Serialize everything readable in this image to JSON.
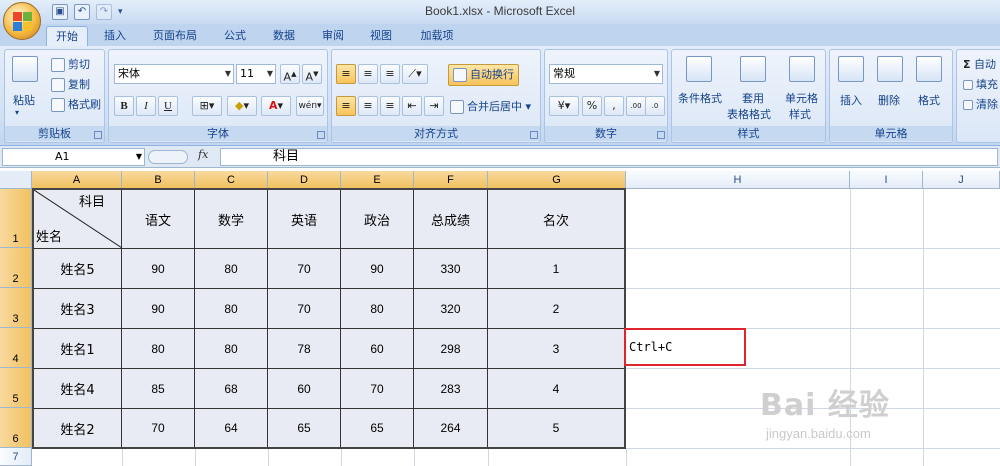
{
  "window": {
    "title": "Book1.xlsx - Microsoft Excel"
  },
  "ribbon": {
    "tabs": [
      "开始",
      "插入",
      "页面布局",
      "公式",
      "数据",
      "审阅",
      "视图",
      "加载项"
    ],
    "active_tab": "开始",
    "clipboard": {
      "paste": "粘贴",
      "cut": "剪切",
      "copy": "复制",
      "format_painter": "格式刷",
      "label": "剪贴板"
    },
    "font": {
      "name": "宋体",
      "size": "11",
      "bold": "B",
      "italic": "I",
      "underline": "U",
      "label": "字体"
    },
    "alignment": {
      "wrap_text": "自动换行",
      "merge_center": "合并后居中",
      "label": "对齐方式"
    },
    "number": {
      "format": "常规",
      "percent": "%",
      "comma": ",",
      "label": "数字"
    },
    "styles": {
      "conditional": "条件格式",
      "table_format_1": "套用",
      "table_format_2": "表格格式",
      "cell_style_1": "单元格",
      "cell_style_2": "样式",
      "label": "样式"
    },
    "cells": {
      "insert": "插入",
      "delete": "删除",
      "format": "格式",
      "label": "单元格"
    },
    "editing": {
      "autosum": "自动",
      "fill": "填充",
      "clear": "清除"
    }
  },
  "formula_bar": {
    "name_box": "A1",
    "fx": "fx",
    "content": "科目"
  },
  "sheet": {
    "columns": [
      "A",
      "B",
      "C",
      "D",
      "E",
      "F",
      "G",
      "H",
      "I",
      "J"
    ],
    "rows": [
      "1",
      "2",
      "3",
      "4",
      "5",
      "6",
      "7"
    ],
    "header": {
      "a1_top": "科目",
      "a1_bottom": "姓名",
      "cols": [
        "语文",
        "数学",
        "英语",
        "政治",
        "总成绩",
        "名次"
      ]
    },
    "data": [
      [
        "姓名5",
        "90",
        "80",
        "70",
        "90",
        "330",
        "1"
      ],
      [
        "姓名3",
        "90",
        "80",
        "70",
        "80",
        "320",
        "2"
      ],
      [
        "姓名1",
        "80",
        "80",
        "78",
        "60",
        "298",
        "3"
      ],
      [
        "姓名4",
        "85",
        "68",
        "60",
        "70",
        "283",
        "4"
      ],
      [
        "姓名2",
        "70",
        "64",
        "65",
        "65",
        "264",
        "5"
      ]
    ],
    "annotation": "Ctrl+C"
  },
  "watermark": {
    "brand": "Bai 经验",
    "url": "jingyan.baidu.com"
  },
  "colors": {
    "selection_header": "#f1c15f",
    "table_fill": "#e8ebf3",
    "annotation_border": "#e0242b"
  }
}
